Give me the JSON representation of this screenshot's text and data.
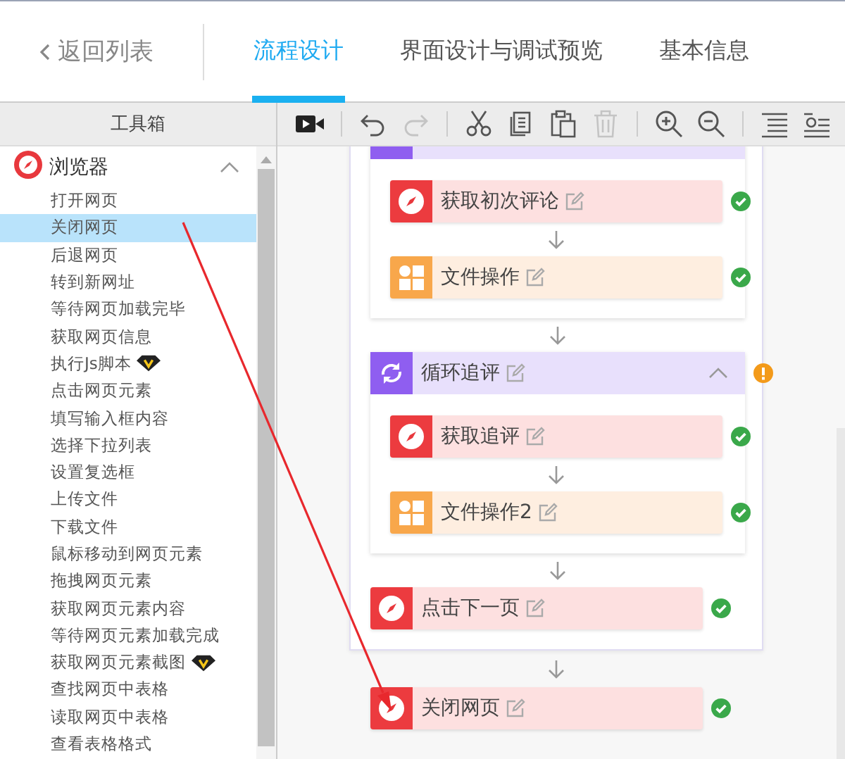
{
  "top_bar": {
    "back_link": "返回列表",
    "tabs": [
      {
        "label": "流程设计",
        "selected": true
      },
      {
        "label": "界面设计与调试预览",
        "selected": false
      },
      {
        "label": "基本信息",
        "selected": false
      }
    ]
  },
  "toolbox": {
    "title": "工具箱",
    "groups": [
      {
        "label": "浏览器",
        "expanded": true,
        "children": [
          {
            "label": "打开网页",
            "selected": false,
            "vip": false
          },
          {
            "label": "关闭网页",
            "selected": true,
            "vip": false
          },
          {
            "label": "后退网页",
            "selected": false,
            "vip": false
          },
          {
            "label": "转到新网址",
            "selected": false,
            "vip": false
          },
          {
            "label": "等待网页加载完毕",
            "selected": false,
            "vip": false
          },
          {
            "label": "获取网页信息",
            "selected": false,
            "vip": false
          },
          {
            "label": "执行Js脚本",
            "selected": false,
            "vip": true
          },
          {
            "label": "点击网页元素",
            "selected": false,
            "vip": false
          },
          {
            "label": "填写输入框内容",
            "selected": false,
            "vip": false
          },
          {
            "label": "选择下拉列表",
            "selected": false,
            "vip": false
          },
          {
            "label": "设置复选框",
            "selected": false,
            "vip": false
          },
          {
            "label": "上传文件",
            "selected": false,
            "vip": false
          },
          {
            "label": "下载文件",
            "selected": false,
            "vip": false
          },
          {
            "label": "鼠标移动到网页元素",
            "selected": false,
            "vip": false
          },
          {
            "label": "拖拽网页元素",
            "selected": false,
            "vip": false
          },
          {
            "label": "获取网页元素内容",
            "selected": false,
            "vip": false
          },
          {
            "label": "等待网页元素加载完成",
            "selected": false,
            "vip": false
          },
          {
            "label": "获取网页元素截图",
            "selected": false,
            "vip": true
          },
          {
            "label": "查找网页中表格",
            "selected": false,
            "vip": false
          },
          {
            "label": "读取网页中表格",
            "selected": false,
            "vip": false
          },
          {
            "label": "查看表格格式",
            "selected": false,
            "vip": false
          }
        ]
      }
    ]
  },
  "toolbar": {
    "buttons": [
      {
        "kind": "record",
        "disabled": false
      },
      {
        "kind": "separator"
      },
      {
        "kind": "undo",
        "disabled": false
      },
      {
        "kind": "redo",
        "disabled": true
      },
      {
        "kind": "separator"
      },
      {
        "kind": "cut",
        "disabled": false
      },
      {
        "kind": "copy",
        "disabled": false
      },
      {
        "kind": "paste",
        "disabled": false
      },
      {
        "kind": "delete",
        "disabled": true
      },
      {
        "kind": "separator"
      },
      {
        "kind": "zoom-in",
        "disabled": false
      },
      {
        "kind": "zoom-out",
        "disabled": false
      },
      {
        "kind": "separator"
      },
      {
        "kind": "align",
        "disabled": false
      },
      {
        "kind": "settings-list",
        "disabled": false
      }
    ]
  },
  "flow": {
    "nodes": [
      {
        "kind": "group",
        "children": [
          {
            "kind": "loop-cut",
            "children": [
              {
                "kind": "browser",
                "title": "获取初次评论",
                "valid": true
              },
              {
                "kind": "file",
                "title": "文件操作",
                "valid": true
              }
            ]
          },
          {
            "kind": "loop",
            "title": "循环追评",
            "expanded": true,
            "valid": false,
            "children": [
              {
                "kind": "browser",
                "title": "获取追评",
                "valid": true
              },
              {
                "kind": "file",
                "title": "文件操作2",
                "valid": true
              }
            ]
          },
          {
            "kind": "browser",
            "title": "点击下一页",
            "valid": true
          }
        ]
      },
      {
        "kind": "browser",
        "title": "关闭网页",
        "valid": true
      }
    ]
  }
}
